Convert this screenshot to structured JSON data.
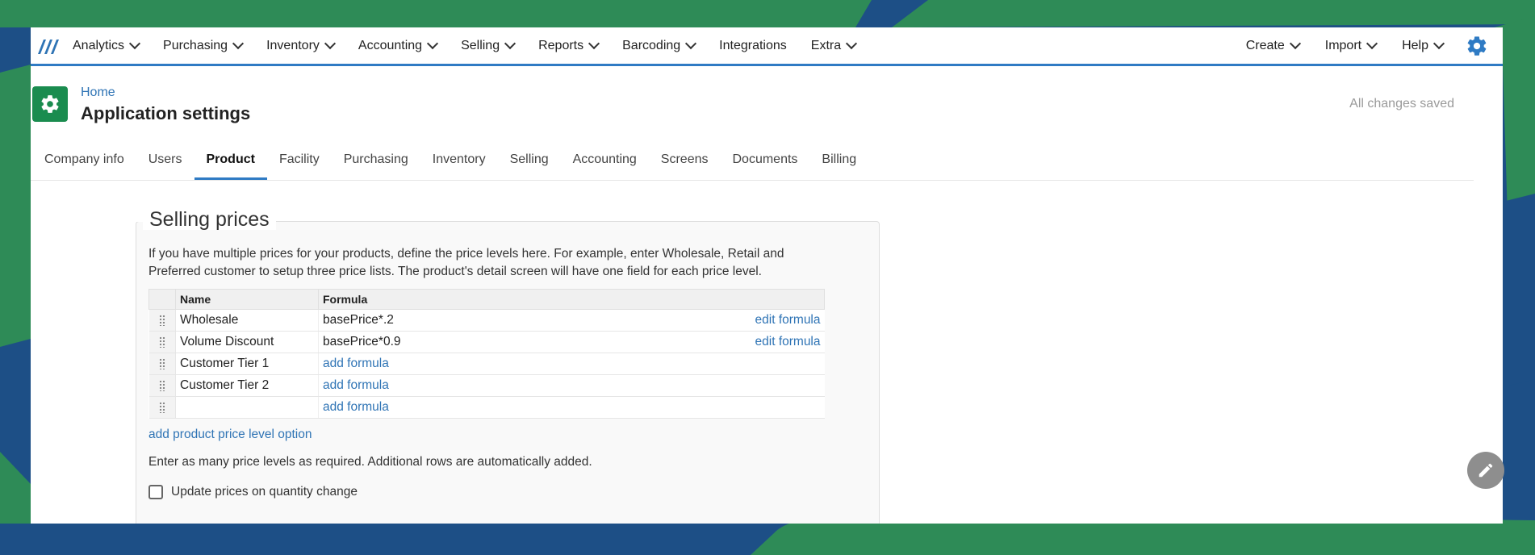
{
  "nav": {
    "left": [
      {
        "label": "Analytics",
        "has_menu": true
      },
      {
        "label": "Purchasing",
        "has_menu": true
      },
      {
        "label": "Inventory",
        "has_menu": true
      },
      {
        "label": "Accounting",
        "has_menu": true
      },
      {
        "label": "Selling",
        "has_menu": true
      },
      {
        "label": "Reports",
        "has_menu": true
      },
      {
        "label": "Barcoding",
        "has_menu": true
      },
      {
        "label": "Integrations",
        "has_menu": false
      },
      {
        "label": "Extra",
        "has_menu": true
      }
    ],
    "right": [
      {
        "label": "Create"
      },
      {
        "label": "Import"
      },
      {
        "label": "Help"
      }
    ],
    "settings_icon": "gear-icon"
  },
  "header": {
    "breadcrumb": "Home",
    "title": "Application settings",
    "save_status": "All changes saved"
  },
  "tabs": [
    {
      "label": "Company info",
      "active": false
    },
    {
      "label": "Users",
      "active": false
    },
    {
      "label": "Product",
      "active": true
    },
    {
      "label": "Facility",
      "active": false
    },
    {
      "label": "Purchasing",
      "active": false
    },
    {
      "label": "Inventory",
      "active": false
    },
    {
      "label": "Selling",
      "active": false
    },
    {
      "label": "Accounting",
      "active": false
    },
    {
      "label": "Screens",
      "active": false
    },
    {
      "label": "Documents",
      "active": false
    },
    {
      "label": "Billing",
      "active": false
    }
  ],
  "selling_prices": {
    "title": "Selling prices",
    "description": "If you have multiple prices for your products, define the price levels here. For example, enter Wholesale, Retail and Preferred customer to setup three price lists. The product's detail screen will have one field for each price level.",
    "columns": [
      "Name",
      "Formula"
    ],
    "rows": [
      {
        "name": "Wholesale",
        "formula": "basePrice*.2",
        "action": "edit formula"
      },
      {
        "name": "Volume Discount",
        "formula": "basePrice*0.9",
        "action": "edit formula"
      },
      {
        "name": "Customer Tier 1",
        "formula": "",
        "action": "add formula"
      },
      {
        "name": "Customer Tier 2",
        "formula": "",
        "action": "add formula"
      },
      {
        "name": "",
        "formula": "",
        "action": "add formula"
      }
    ],
    "add_option_label": "add product price level option",
    "hint": "Enter as many price levels as required. Additional rows are automatically added.",
    "update_on_qty_label": "Update prices on quantity change",
    "update_on_qty_checked": false
  },
  "colors": {
    "accent": "#2f7bc4",
    "link": "#2f74b5",
    "settings_icon_bg": "#1a8c4f",
    "bg_blue": "#1d4f86",
    "bg_green": "#2e8b57"
  }
}
